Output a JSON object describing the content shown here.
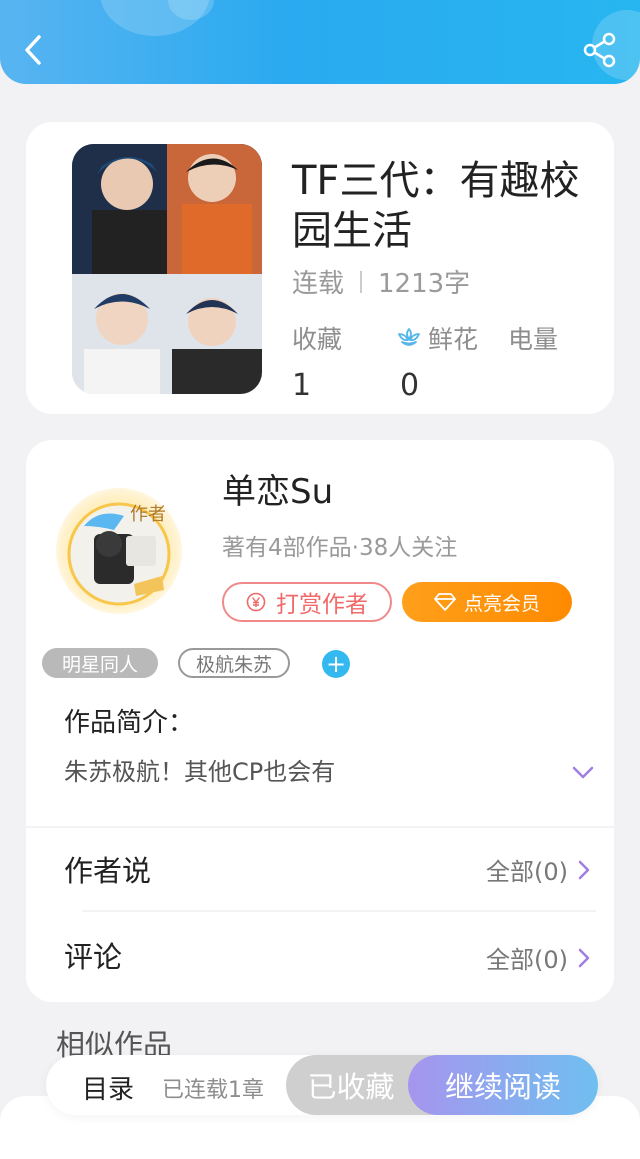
{
  "book": {
    "title": "TF三代：有趣校园生活",
    "status": "连载",
    "word_count": "1213字",
    "stats": {
      "favorites_label": "收藏",
      "flowers_label": "鲜花",
      "power_label": "电量",
      "favorites_value": "1",
      "flowers_value": "0"
    }
  },
  "author": {
    "name": "单恋Su",
    "badge": "作者",
    "meta": "著有4部作品·38人关注",
    "reward_label": "打赏作者",
    "vip_label": "点亮会员"
  },
  "tags": [
    "明星同人",
    "极航朱苏"
  ],
  "intro": {
    "title": "作品简介：",
    "text": "朱苏极航！其他CP也会有"
  },
  "rows": {
    "author_says_label": "作者说",
    "author_says_value": "全部(0)",
    "comments_label": "评论",
    "comments_value": "全部(0)"
  },
  "similar_title": "相似作品",
  "bottom_bar": {
    "toc_label": "目录",
    "chapter_count": "已连载1章",
    "favorited_label": "已收藏",
    "continue_label": "继续阅读"
  },
  "colors": {
    "header_blue": "#2aaaf0",
    "reward_red": "#f06a6a",
    "vip_orange": "#ff8a00",
    "accent_purple": "#a07ee0"
  }
}
